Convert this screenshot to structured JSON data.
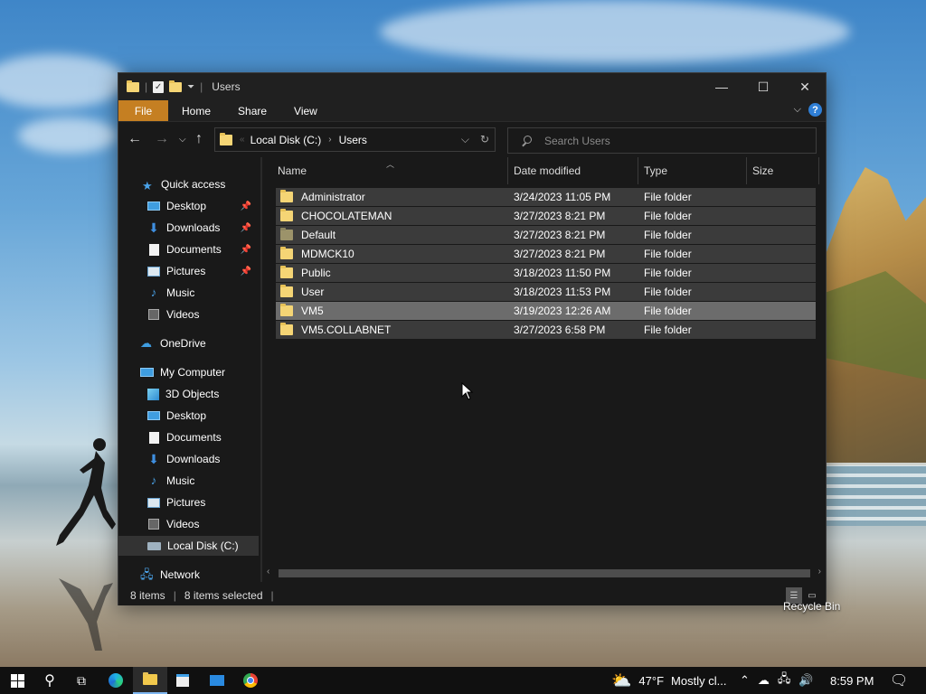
{
  "window": {
    "title": "Users",
    "controls": {
      "minimize": "—",
      "maximize": "☐",
      "close": "✕"
    }
  },
  "ribbon": {
    "tabs": [
      "File",
      "Home",
      "Share",
      "View"
    ],
    "help": "?"
  },
  "address": {
    "crumbs": [
      "Local Disk (C:)",
      "Users"
    ]
  },
  "search": {
    "placeholder": "Search Users"
  },
  "nav": {
    "quick_access": "Quick access",
    "quick_items": [
      {
        "label": "Desktop",
        "icon": "desktop-icon",
        "pinned": true
      },
      {
        "label": "Downloads",
        "icon": "download-arrow-icon",
        "pinned": true
      },
      {
        "label": "Documents",
        "icon": "document-icon",
        "pinned": true
      },
      {
        "label": "Pictures",
        "icon": "picture-icon",
        "pinned": true
      },
      {
        "label": "Music",
        "icon": "music-note-icon",
        "pinned": false
      },
      {
        "label": "Videos",
        "icon": "video-icon",
        "pinned": false
      }
    ],
    "onedrive": "OneDrive",
    "my_computer": "My Computer",
    "pc_items": [
      {
        "label": "3D Objects",
        "icon": "3d-objects-icon"
      },
      {
        "label": "Desktop",
        "icon": "desktop-icon"
      },
      {
        "label": "Documents",
        "icon": "document-icon"
      },
      {
        "label": "Downloads",
        "icon": "download-arrow-icon"
      },
      {
        "label": "Music",
        "icon": "music-note-icon"
      },
      {
        "label": "Pictures",
        "icon": "picture-icon"
      },
      {
        "label": "Videos",
        "icon": "video-icon"
      },
      {
        "label": "Local Disk (C:)",
        "icon": "local-disk-icon",
        "selected": true
      }
    ],
    "network": "Network"
  },
  "columns": {
    "name": "Name",
    "date": "Date modified",
    "type": "Type",
    "size": "Size"
  },
  "files": [
    {
      "name": "Administrator",
      "date": "3/24/2023 11:05 PM",
      "type": "File folder"
    },
    {
      "name": "CHOCOLATEMAN",
      "date": "3/27/2023 8:21 PM",
      "type": "File folder"
    },
    {
      "name": "Default",
      "date": "3/27/2023 8:21 PM",
      "type": "File folder",
      "hidden": true
    },
    {
      "name": "MDMCK10",
      "date": "3/27/2023 8:21 PM",
      "type": "File folder"
    },
    {
      "name": "Public",
      "date": "3/18/2023 11:50 PM",
      "type": "File folder"
    },
    {
      "name": "User",
      "date": "3/18/2023 11:53 PM",
      "type": "File folder"
    },
    {
      "name": "VM5",
      "date": "3/19/2023 12:26 AM",
      "type": "File folder",
      "hover": true
    },
    {
      "name": "VM5.COLLABNET",
      "date": "3/27/2023 6:58 PM",
      "type": "File folder"
    }
  ],
  "status": {
    "count": "8 items",
    "selected": "8 items selected"
  },
  "desktop": {
    "recycle_bin": "Recycle Bin"
  },
  "taskbar": {
    "weather_temp": "47°F",
    "weather_text": "Mostly cl...",
    "time": "8:59 PM"
  },
  "colors": {
    "file_tab": "#c57f22",
    "selection": "#3b3b3b",
    "hover": "#6c6c6c",
    "accent": "#2f7fd6"
  }
}
